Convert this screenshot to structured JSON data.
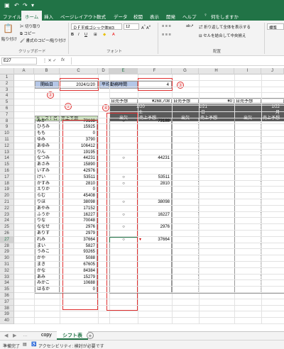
{
  "titlebar": {
    "save_icon": "save-icon",
    "undo_icon": "undo-icon",
    "redo_icon": "redo-icon"
  },
  "menu": {
    "tabs": [
      "ファイル",
      "ホーム",
      "挿入",
      "ページレイアウト",
      "数式",
      "データ",
      "校閲",
      "表示",
      "開発",
      "ヘルプ"
    ],
    "active": "ホーム",
    "search": "何をしますか"
  },
  "ribbon": {
    "paste": "貼り付け",
    "cut": "切り取り",
    "copy": "コピー",
    "format_painter": "書式のコピー/貼り付け",
    "clipboard_group": "クリップボード",
    "font_name": "ＤＦ平成ゴシック体W3",
    "font_size": "12",
    "font_group": "フォント",
    "wrap": "折り返して全体を表示する",
    "merge": "セルを結合して中央揃え",
    "align_group": "配置",
    "number_format": "標準"
  },
  "formula": {
    "namebox": "E27",
    "fx": "fx"
  },
  "columns": [
    "A",
    "B",
    "C",
    "D",
    "E",
    "F",
    "G",
    "H",
    "I",
    "J"
  ],
  "rows": [
    "1",
    "2",
    "3",
    "4",
    "5",
    "6",
    "7",
    "8",
    "9",
    "10",
    "11",
    "12",
    "13",
    "14",
    "15",
    "16",
    "17",
    "18",
    "19",
    "20",
    "21",
    "22",
    "23",
    "24",
    "25",
    "26",
    "27",
    "28",
    "29",
    "30",
    "31",
    "32",
    "33",
    "34",
    "35",
    "36",
    "37",
    "38",
    "39",
    "40"
  ],
  "header": {
    "start_label": "開始日",
    "start_value": "2024/1/20",
    "avg_label": "平均勤務時間",
    "avg_value": "4"
  },
  "forecast": {
    "label1": "日売予想",
    "value1": "¥268,708",
    "label2": "日売予想",
    "value2": "¥0",
    "label3": "日売予想"
  },
  "dates": {
    "d1": "1/20",
    "d2": "1/21",
    "d3": "1/22",
    "w1": "土",
    "w2": "日",
    "w3": "月"
  },
  "col_headers": {
    "cast": "キャスト名",
    "sales": "売上予測",
    "attend": "出欠",
    "day_sales": "売上予想"
  },
  "cast": [
    {
      "name": "みか",
      "sales": "73188",
      "mark": "○",
      "day": "73188"
    },
    {
      "name": "ひろみ",
      "sales": "15925",
      "mark": "",
      "day": ""
    },
    {
      "name": "もも",
      "sales": "0",
      "mark": "",
      "day": ""
    },
    {
      "name": "ゆみ",
      "sales": "3790",
      "mark": "",
      "day": ""
    },
    {
      "name": "あゆみ",
      "sales": "106412",
      "mark": "",
      "day": ""
    },
    {
      "name": "りん",
      "sales": "19195",
      "mark": "",
      "day": ""
    },
    {
      "name": "なつみ",
      "sales": "44231",
      "mark": "○",
      "day": "44231"
    },
    {
      "name": "あさみ",
      "sales": "15890",
      "mark": "",
      "day": ""
    },
    {
      "name": "いずみ",
      "sales": "42976",
      "mark": "",
      "day": ""
    },
    {
      "name": "けい",
      "sales": "53511",
      "mark": "○",
      "day": "53511"
    },
    {
      "name": "かすみ",
      "sales": "2810",
      "mark": "○",
      "day": "2810"
    },
    {
      "name": "えりか",
      "sales": "0",
      "mark": "",
      "day": ""
    },
    {
      "name": "らむ",
      "sales": "45408",
      "mark": "",
      "day": ""
    },
    {
      "name": "りほ",
      "sales": "38098",
      "mark": "○",
      "day": "38098"
    },
    {
      "name": "あやみ",
      "sales": "17152",
      "mark": "",
      "day": ""
    },
    {
      "name": "ふうか",
      "sales": "16227",
      "mark": "○",
      "day": "16227"
    },
    {
      "name": "りな",
      "sales": "70048",
      "mark": "",
      "day": ""
    },
    {
      "name": "ななせ",
      "sales": "2976",
      "mark": "○",
      "day": "2976"
    },
    {
      "name": "ありす",
      "sales": "2979",
      "mark": "",
      "day": ""
    },
    {
      "name": "れみ",
      "sales": "37664",
      "mark": "○",
      "day": "37664"
    },
    {
      "name": "まい",
      "sales": "5827",
      "mark": "",
      "day": ""
    },
    {
      "name": "うみこ",
      "sales": "93265",
      "mark": "",
      "day": ""
    },
    {
      "name": "かや",
      "sales": "5088",
      "mark": "",
      "day": ""
    },
    {
      "name": "まき",
      "sales": "67605",
      "mark": "",
      "day": ""
    },
    {
      "name": "かな",
      "sales": "84384",
      "mark": "",
      "day": ""
    },
    {
      "name": "あみ",
      "sales": "15279",
      "mark": "",
      "day": ""
    },
    {
      "name": "みかこ",
      "sales": "10688",
      "mark": "",
      "day": ""
    },
    {
      "name": "はるか",
      "sales": "0",
      "mark": "",
      "day": ""
    }
  ],
  "callouts": {
    "c1": "①",
    "c2": "②",
    "c3": "③",
    "c4": "④"
  },
  "sheets": {
    "tab1": "copy",
    "tab2": "シフト表",
    "add": "+"
  },
  "status": {
    "ready": "準備完了",
    "accessibility": "アクセシビリティ: 検討が必要です"
  },
  "colors": {
    "excel_green": "#217346",
    "header_fill": "#5a5a5a",
    "name_fill": "#c6e0b4",
    "label_fill": "#b4c6e7",
    "callout": "#e03030"
  }
}
